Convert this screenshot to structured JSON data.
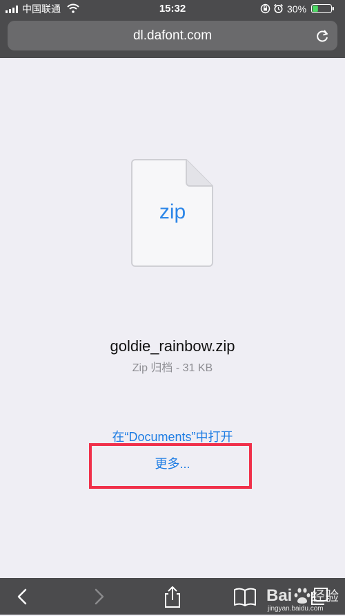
{
  "status_bar": {
    "carrier": "中国联通",
    "time": "15:32",
    "battery_percent": "30%",
    "battery_level": 0.3,
    "icons": [
      "signal-icon",
      "wifi-icon",
      "rotation-lock-icon",
      "alarm-icon",
      "battery-icon"
    ]
  },
  "browser": {
    "url": "dl.dafont.com",
    "icons": [
      "reload-icon"
    ]
  },
  "download": {
    "extension": "zip",
    "file_name": "goldie_rainbow.zip",
    "meta": "Zip 归档 - 31 KB",
    "open_in_label": "在“Documents”中打开",
    "more_label": "更多...",
    "icons": [
      "zip-file-icon"
    ]
  },
  "toolbar": {
    "icons": [
      "back-icon",
      "forward-icon",
      "share-icon",
      "bookmarks-icon",
      "tabs-icon"
    ]
  },
  "watermark": {
    "brand": "Bai 经验",
    "site": "jingyan.baidu.com"
  },
  "colors": {
    "chrome": "#4b4b4d",
    "url_field": "#6a6a6c",
    "page_background": "#efeef4",
    "link": "#1d7ce3",
    "zip_text": "#2c86e8",
    "highlight": "#f0304a",
    "battery_fill": "#4cd964"
  }
}
